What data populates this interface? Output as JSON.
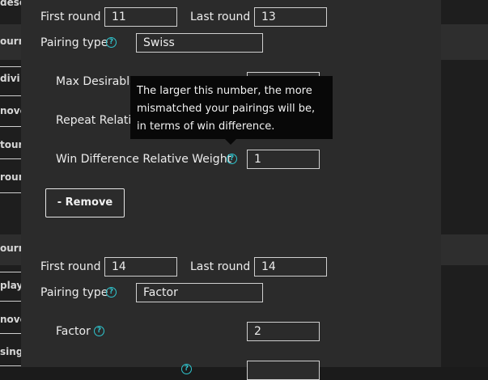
{
  "background_page": {
    "items": [
      "desc",
      "ourn",
      "divi",
      "nove",
      "tourn",
      "roun",
      "ourn",
      "play",
      "nove",
      "tourn",
      "singl"
    ]
  },
  "rounds": [
    {
      "first_round_label": "First round",
      "first_round_value": "11",
      "last_round_label": "Last round",
      "last_round_value": "13",
      "pairing_type_label": "Pairing type",
      "pairing_type_value": "Swiss",
      "settings": [
        {
          "label": "Max Desirable",
          "value": ""
        },
        {
          "label": "Repeat Relativ",
          "value": ""
        },
        {
          "label": "Win Difference Relative Weight",
          "value": "1"
        }
      ],
      "remove_label": "- Remove"
    },
    {
      "first_round_label": "First round",
      "first_round_value": "14",
      "last_round_label": "Last round",
      "last_round_value": "14",
      "pairing_type_label": "Pairing type",
      "pairing_type_value": "Factor",
      "settings": [
        {
          "label": "Factor",
          "value": "2"
        }
      ]
    }
  ],
  "tooltip": {
    "text": "The larger this number, the more mismatched your pairings will be, in terms of win difference."
  },
  "colors": {
    "accent": "#2fc6cf",
    "modal_bg": "#2b2b2b",
    "tooltip_bg": "#080808"
  }
}
